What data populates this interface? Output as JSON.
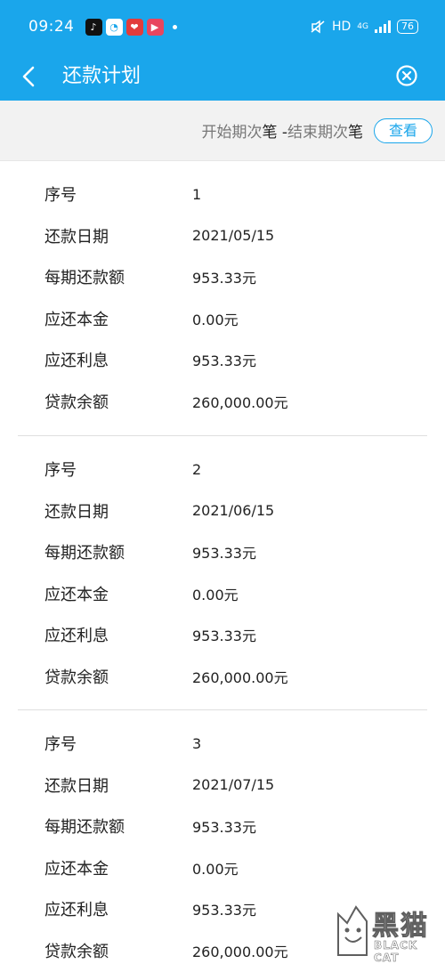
{
  "status_bar": {
    "time": "09:24",
    "network": "HD",
    "network_type": "4G",
    "battery": "76",
    "app_icons": [
      "tiktok-icon",
      "app-icon",
      "app-icon",
      "app-icon"
    ]
  },
  "nav": {
    "title": "还款计划",
    "back_icon": "chevron-left-icon",
    "close_icon": "close-circle-icon"
  },
  "filter": {
    "start_label": "开始期次",
    "start_unit": "笔",
    "separator": " -",
    "end_label": "结束期次",
    "end_unit": "笔",
    "view_button": "查看"
  },
  "records": [
    {
      "rows": [
        {
          "label": "序号",
          "value": "1"
        },
        {
          "label": "还款日期",
          "value": "2021/05/15"
        },
        {
          "label": "每期还款额",
          "value": "953.33元"
        },
        {
          "label": "应还本金",
          "value": "0.00元"
        },
        {
          "label": "应还利息",
          "value": "953.33元"
        },
        {
          "label": "贷款余额",
          "value": "260,000.00元"
        }
      ]
    },
    {
      "rows": [
        {
          "label": "序号",
          "value": "2"
        },
        {
          "label": "还款日期",
          "value": "2021/06/15"
        },
        {
          "label": "每期还款额",
          "value": "953.33元"
        },
        {
          "label": "应还本金",
          "value": "0.00元"
        },
        {
          "label": "应还利息",
          "value": "953.33元"
        },
        {
          "label": "贷款余额",
          "value": "260,000.00元"
        }
      ]
    },
    {
      "rows": [
        {
          "label": "序号",
          "value": "3"
        },
        {
          "label": "还款日期",
          "value": "2021/07/15"
        },
        {
          "label": "每期还款额",
          "value": "953.33元"
        },
        {
          "label": "应还本金",
          "value": "0.00元"
        },
        {
          "label": "应还利息",
          "value": "953.33元"
        },
        {
          "label": "贷款余额",
          "value": "260,000.00元"
        }
      ]
    }
  ],
  "watermark": {
    "text": "黑猫",
    "sub": "BLACK CAT"
  },
  "colors": {
    "accent": "#1aa6eb",
    "filter_bg": "#f2f2f2",
    "divider": "#dedede"
  }
}
